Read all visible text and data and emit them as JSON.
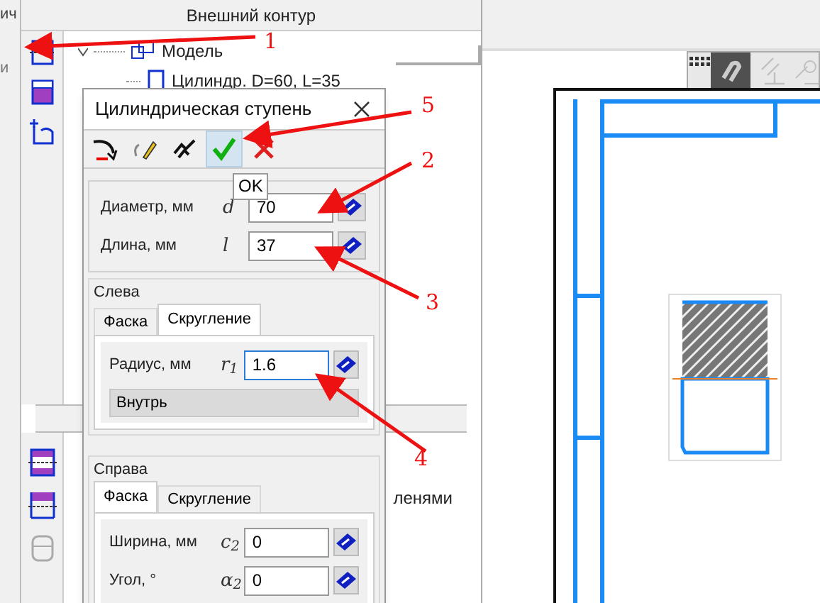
{
  "left_strip": [
    "ич",
    "и"
  ],
  "tree_panel": {
    "title": "Внешний контур",
    "items": [
      {
        "label": "Модель",
        "expanded": true,
        "children": [
          {
            "label": "Цилиндр. D=60, L=35"
          }
        ]
      }
    ]
  },
  "lower_panel": {
    "text": "ленями"
  },
  "dialog": {
    "title": "Цилиндрическая ступень",
    "tooltip": "OK",
    "toolbar": [
      {
        "kind": "back",
        "selected": false
      },
      {
        "kind": "edit",
        "selected": false
      },
      {
        "kind": "params",
        "selected": false
      },
      {
        "kind": "ok",
        "selected": true
      },
      {
        "kind": "cancel",
        "selected": false
      }
    ],
    "main_fields": [
      {
        "label": "Диаметр, мм",
        "symbol": "d",
        "value": "70",
        "focused": false
      },
      {
        "label": "Длина, мм",
        "symbol": "l",
        "value": "37",
        "focused": false
      }
    ],
    "left_group": {
      "title": "Слева",
      "tabs": [
        {
          "label": "Фаска",
          "selected": false
        },
        {
          "label": "Скругление",
          "selected": true
        }
      ],
      "fields": [
        {
          "label": "Радиус, мм",
          "symbol": "r$_{1}$",
          "value": "1.6",
          "focused": true
        }
      ],
      "dropdown": "Внутрь"
    },
    "right_group": {
      "title": "Справа",
      "tabs": [
        {
          "label": "Фаска",
          "selected": true
        },
        {
          "label": "Скругление",
          "selected": false
        }
      ],
      "fields": [
        {
          "label": "Ширина, мм",
          "symbol": "c$_{2}$",
          "value": "0",
          "focused": false
        },
        {
          "label": "Угол, °",
          "symbol": "α$_{2}$",
          "value": "0",
          "focused": false
        }
      ]
    }
  },
  "annotations": [
    {
      "label": "1"
    },
    {
      "label": "2"
    },
    {
      "label": "3"
    },
    {
      "label": "4"
    },
    {
      "label": "5"
    }
  ]
}
